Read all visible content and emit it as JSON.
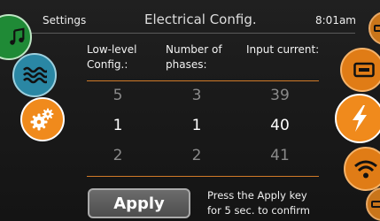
{
  "header": {
    "left_label": "Settings",
    "title": "Electrical Config.",
    "time": "8:01am"
  },
  "columns": [
    {
      "label_line1": "Low-level",
      "label_line2": "Config.:",
      "values": [
        "5",
        "1",
        "2"
      ]
    },
    {
      "label_line1": "Number of",
      "label_line2": "phases:",
      "values": [
        "3",
        "1",
        "2"
      ]
    },
    {
      "label_line1": "Input current:",
      "label_line2": "",
      "values": [
        "39",
        "40",
        "41"
      ]
    }
  ],
  "apply": {
    "label": "Apply",
    "hint_line1": "Press the Apply key",
    "hint_line2": "for 5 sec. to confirm"
  },
  "icons": {
    "left": [
      "music-icon",
      "water-waves-icon",
      "gears-icon"
    ],
    "right": [
      "menu-icon",
      "screen-icon",
      "lightning-bolt-icon",
      "wifi-icon",
      "menu-icon"
    ]
  },
  "colors": {
    "accent": "#f08a1c",
    "green": "#1f8a36",
    "teal": "#2a87a4",
    "rule": "#d07a28"
  }
}
